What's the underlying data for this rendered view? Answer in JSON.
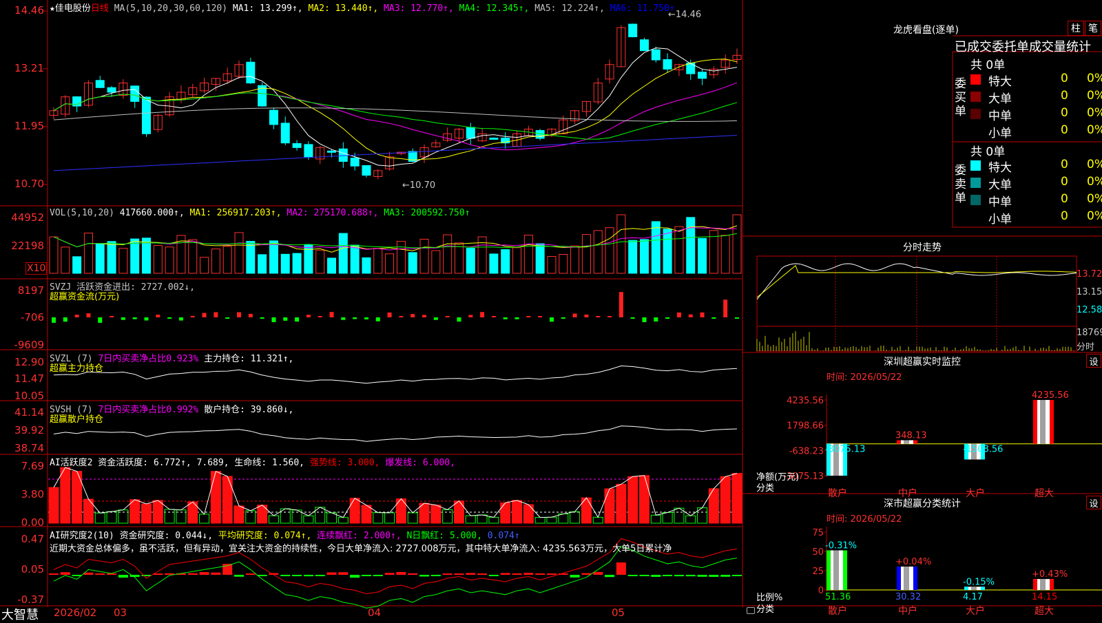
{
  "stock": {
    "name": "佳电股份",
    "star": "★",
    "period": "日线",
    "ma_header": "MA(5,10,20,30,60,120)",
    "ma": [
      {
        "label": "MA1: 13.299↑,",
        "color": "#ffffff"
      },
      {
        "label": "MA2: 13.440↑,",
        "color": "#ffff00"
      },
      {
        "label": "MA3: 12.770↑,",
        "color": "#ff00ff"
      },
      {
        "label": "MA4: 12.345↑,",
        "color": "#00ff00"
      },
      {
        "label": "MA5: 12.224↑,",
        "color": "#c0c0c0"
      },
      {
        "label": "MA6: 11.750↑",
        "color": "#0000ff"
      }
    ],
    "price_axis": [
      "14.46",
      "13.21",
      "11.95",
      "10.70"
    ],
    "high_mark": "14.46",
    "low_mark": "←10.70"
  },
  "vol": {
    "header": "VOL(5,10,20)",
    "value": "417660.000↑,",
    "ma": [
      {
        "label": "MA1: 256917.203↑,",
        "color": "#ffff00"
      },
      {
        "label": "MA2: 275170.688↑,",
        "color": "#ff00ff"
      },
      {
        "label": "MA3: 200592.750↑",
        "color": "#00ff00"
      }
    ],
    "axis": [
      "44952",
      "22198"
    ],
    "unit": "X10"
  },
  "svzj": {
    "header": "SVZJ  活跃资金进出: 2727.002↓,",
    "sub": "超赢资金流(万元)",
    "axis": [
      "8197",
      "-706",
      "-9609"
    ]
  },
  "svzl": {
    "header_a": "SVZL (7)",
    "header_b": "7日内买卖净占比0.923%",
    "header_c": "主力持仓: 11.321↑,",
    "sub": "超赢主力持仓",
    "axis": [
      "12.90",
      "11.47",
      "10.05"
    ]
  },
  "svsh": {
    "header_a": "SVSH (7)",
    "header_b": "7日内买卖净占比0.992%",
    "header_c": "散户持仓: 39.860↓,",
    "sub": "超赢散户持仓",
    "axis": [
      "41.14",
      "39.92",
      "38.74"
    ]
  },
  "ai1": {
    "header_a": "AI活跃度2 资金活跃度: 6.772↑,",
    "header_b": "7.689,",
    "header_c": "生命线: 1.560,",
    "header_d": "强势线: 3.000,",
    "header_e": "爆发线: 6.000,",
    "axis": [
      "7.69",
      "3.80",
      "0.00"
    ]
  },
  "ai2": {
    "header_a": "AI研究度2(10) 资金研究度: 0.044↓,",
    "header_b": "平均研究度: 0.074↑,",
    "header_c": "连续飘红: 2.000↑,",
    "header_d": "N日飘红: 5.000,",
    "header_e": "0.074↑",
    "commentary": "近期大资金总体偏多，虽不活跃，但有异动，宜关注大资金的持续性，今日大单净流入: 2727.008万元，其中特大单净流入: 4235.563万元，大单5日累计净",
    "axis": [
      "0.47",
      "0.05",
      "-0.37"
    ]
  },
  "bottom": {
    "brand": "大智慧",
    "dates": [
      "2026/02",
      "03",
      "04",
      "05"
    ]
  },
  "dragon": {
    "title": "龙虎看盘(逐单)",
    "btn1": "柱",
    "btn2": "笔",
    "table_title": "已成交委托单成交量统计",
    "buy_label": "委买单",
    "sell_label": "委卖单",
    "buy_total": "共 0单",
    "sell_total": "共 0单",
    "buy_rows": [
      {
        "label": "特大",
        "count": "0",
        "pct": "0%",
        "color": "#ff0000"
      },
      {
        "label": "大单",
        "count": "0",
        "pct": "0%",
        "color": "#8b0000"
      },
      {
        "label": "中单",
        "count": "0",
        "pct": "0%",
        "color": "#5a0000"
      },
      {
        "label": "小单",
        "count": "0",
        "pct": "0%",
        "color": ""
      }
    ],
    "sell_rows": [
      {
        "label": "特大",
        "count": "0",
        "pct": "0%",
        "color": "#00ffff"
      },
      {
        "label": "大单",
        "count": "0",
        "pct": "0%",
        "color": "#009999"
      },
      {
        "label": "中单",
        "count": "0",
        "pct": "0%",
        "color": "#006666"
      },
      {
        "label": "小单",
        "count": "0",
        "pct": "0%",
        "color": ""
      }
    ]
  },
  "intraday": {
    "title": "分时走势",
    "axis": [
      "13.72",
      "13.15",
      "12.58",
      "18769",
      "分时"
    ]
  },
  "sz_monitor": {
    "title": "深圳超赢实时监控",
    "settings": "设",
    "time": "时间: 2026/05/22",
    "ylabel": "净额(万元)",
    "xlabel": "分类",
    "axis": [
      "4235.56",
      "1798.66",
      "-638.23",
      "-3075.13"
    ]
  },
  "sz_stats": {
    "title": "深市超赢分类统计",
    "settings": "设",
    "time": "时间: 2026/05/22",
    "ylabel": "比例%",
    "xlabel": "分类",
    "axis": [
      "75",
      "50",
      "25",
      "0"
    ]
  },
  "chart_data": [
    {
      "type": "bar",
      "title": "深圳超赢实时监控",
      "ylabel": "净额(万元)",
      "xlabel": "分类",
      "categories": [
        "散户",
        "中户",
        "大户",
        "超大"
      ],
      "values": [
        -3075.13,
        348.13,
        -1508.56,
        4235.56
      ],
      "labels": [
        "-3075.13",
        "348.13",
        "-1508.56",
        "4235.56"
      ],
      "ylim": [
        -3075.13,
        4235.56
      ],
      "colors": [
        "#00ffff",
        "#ff0000",
        "#00ffff",
        "#ff0000"
      ]
    },
    {
      "type": "bar",
      "title": "深市超赢分类统计",
      "ylabel": "比例%",
      "xlabel": "分类",
      "categories": [
        "散户",
        "中户",
        "大户",
        "超大"
      ],
      "values": [
        51.36,
        30.32,
        4.17,
        14.15
      ],
      "top_labels": [
        "-0.31%",
        "+0.04%",
        "-0.15%",
        "+0.43%"
      ],
      "bottom_labels": [
        "51.36",
        "30.32",
        "4.17",
        "14.15"
      ],
      "ylim": [
        0,
        75
      ],
      "colors": [
        "#00ff00",
        "#0000ff",
        "#00ffff",
        "#ff0000"
      ]
    }
  ]
}
